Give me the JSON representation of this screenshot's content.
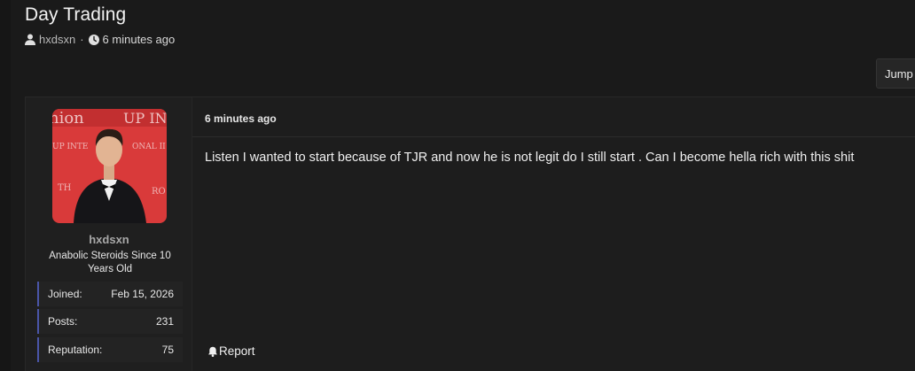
{
  "thread": {
    "title": "Day Trading",
    "author": "hxdsxn",
    "separator": "·",
    "posted_ago": "6 minutes ago"
  },
  "toolbar": {
    "jump_label": "Jump"
  },
  "post": {
    "time": "6 minutes ago",
    "body": "Listen I wanted to start because of TJR and now he is not legit do I still start . Can I become hella rich with this shit",
    "report_label": "Report",
    "user": {
      "username": "hxdsxn",
      "title": "Anabolic Steroids Since 10 Years Old",
      "stats": [
        {
          "label": "Joined:",
          "value": "Feb 15, 2026"
        },
        {
          "label": "Posts:",
          "value": "231"
        },
        {
          "label": "Reputation:",
          "value": "75"
        }
      ]
    }
  },
  "colors": {
    "background": "#1a1a1a",
    "panel": "#1f1f1f",
    "accent_bar": "#4a55a8",
    "avatar_bg": "#d93a3a"
  },
  "icons": {
    "author": "user-icon",
    "time": "clock-icon",
    "report": "bell-icon"
  }
}
